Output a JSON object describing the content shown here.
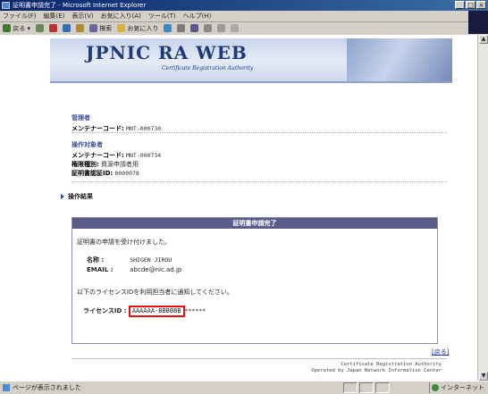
{
  "window": {
    "title": "証明書申請完了 - Microsoft Internet Explorer",
    "controls": [
      "_",
      "□",
      "×"
    ]
  },
  "menu": [
    "ファイル(F)",
    "編集(E)",
    "表示(V)",
    "お気に入り(A)",
    "ツール(T)",
    "ヘルプ(H)"
  ],
  "toolbar": {
    "back": "戻る",
    "search": "検索",
    "favorites": "お気に入り"
  },
  "banner": {
    "brand": "JPNIC RA WEB",
    "subtitle": "Certificate Registration Authority"
  },
  "admin": {
    "heading": "管理者",
    "label": "メンテナーコード:",
    "value": "MNT-000730"
  },
  "operator": {
    "heading": "操作対象者",
    "maintainer_label": "メンテナーコード:",
    "maintainer_value": "MNT-000734",
    "role_label": "権限種別:",
    "role_value": "資源申請者用",
    "cert_label": "証明書認証ID:",
    "cert_value": "0000078"
  },
  "result": {
    "heading": "操作結果",
    "panel_title": "証明書申請完了",
    "accepted_msg": "証明書の申請を受け付けました。",
    "name_label": "名称 :",
    "name_value": "SHIGEN JIROU",
    "email_label": "EMAIL :",
    "email_value": "abcde@nic.ad.jp",
    "notify_msg": "以下のライセンスIDを利用担当者に通知してください。",
    "license_label": "ライセンスID :",
    "license_value": "AAAAAA-BBBBBB",
    "license_mask": "******"
  },
  "back_link": "[戻る]",
  "footer": {
    "line1": "Certificate Registration Authority",
    "line2": "Operated by Japan Network Information Center"
  },
  "status": {
    "left": "ページが表示されました",
    "zone": "インターネット"
  }
}
